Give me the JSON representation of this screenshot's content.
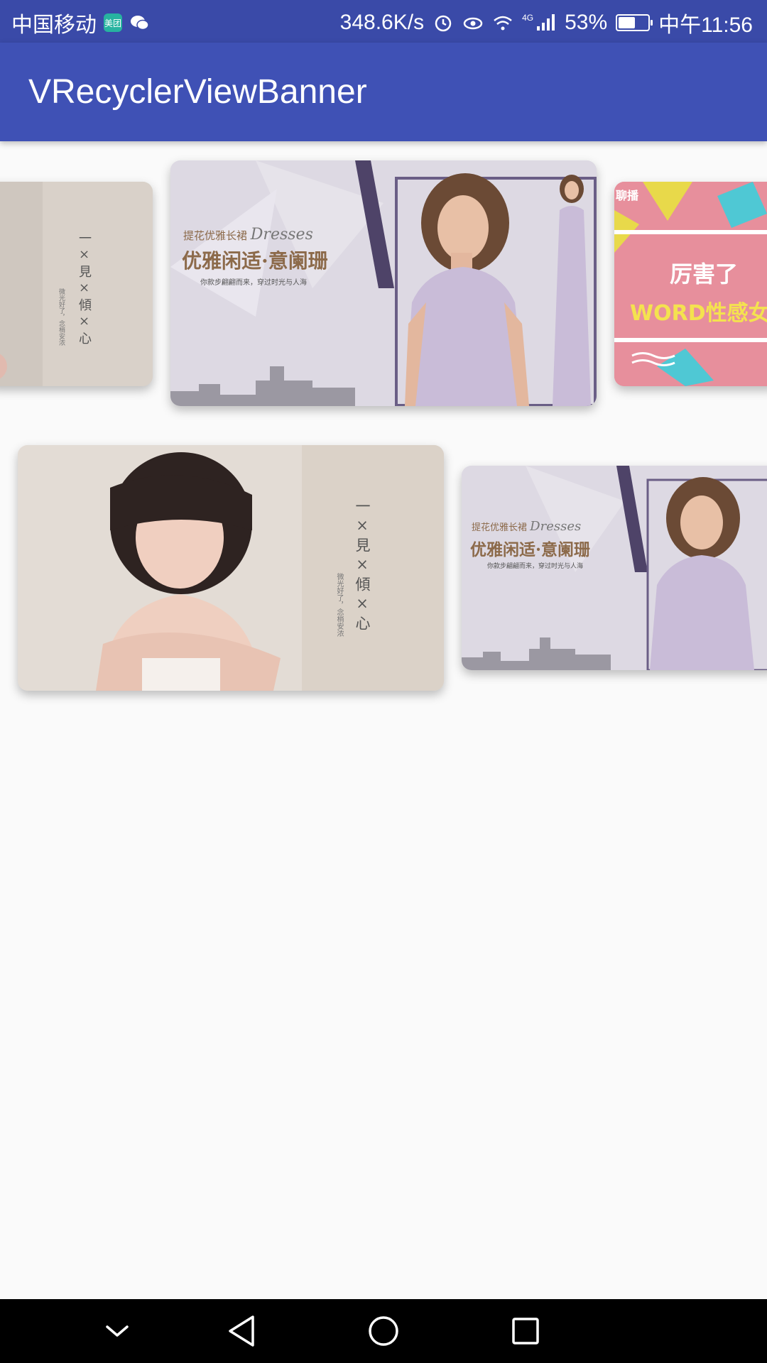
{
  "status_bar": {
    "carrier": "中国移动",
    "app_badge": "美团",
    "net_speed": "348.6K/s",
    "network_type": "4G",
    "battery_text": "53%",
    "battery_level": 0.53,
    "time": "中午11:56"
  },
  "app_bar": {
    "title": "VRecyclerViewBanner"
  },
  "banner1": {
    "left_card": {
      "v_title": "一×見×傾×心",
      "v_sub": "微光好了，念梢安浓"
    },
    "center_card": {
      "line1": "提花优雅长裙",
      "line1_script": "Dresses",
      "headline": "优雅闲适·意阑珊",
      "tagline": "你款步翩翩而来，穿过时光与人海"
    },
    "right_card": {
      "badge": "聊播",
      "line1": "厉害了",
      "line2": "WORD性感女"
    }
  },
  "banner2": {
    "center_card": {
      "v_title": "一×見×傾×心",
      "v_sub": "微光好了，念梢安浓"
    },
    "right_card": {
      "line1": "提花优雅长裙",
      "line1_script": "Dresses",
      "headline": "优雅闲适·意阑珊",
      "tagline": "你款步翩翩而来，穿过时光与人海"
    }
  },
  "nav_bar": {
    "icons": [
      "chevron-down-icon",
      "back-icon",
      "home-icon",
      "recents-icon"
    ]
  },
  "colors": {
    "status_bar": "#3a4aa8",
    "app_bar": "#3f51b5",
    "background": "#fafafa",
    "nav_bar": "#000000",
    "dress": "#c9bcd8",
    "pink_card": "#e78f9c"
  }
}
